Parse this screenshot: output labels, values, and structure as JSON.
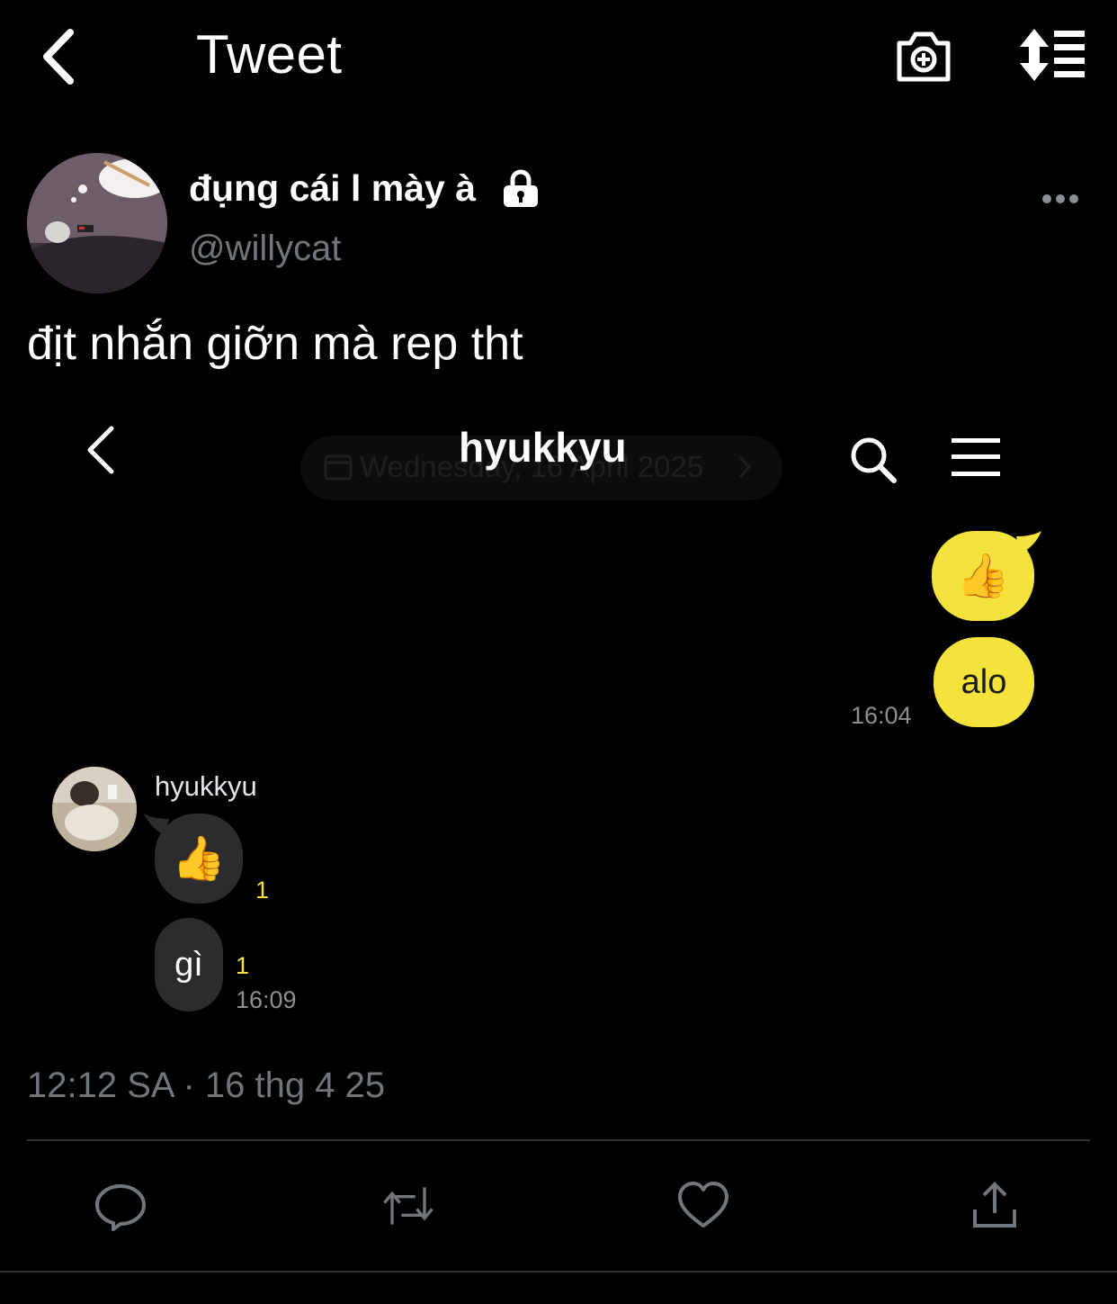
{
  "header": {
    "title": "Tweet"
  },
  "tweet": {
    "author_name": "đụng cái l mày à",
    "author_handle": "@willycat",
    "text": "địt nhắn giỡn mà rep tht",
    "timestamp": "12:12 SA · 16 thg 4 25"
  },
  "chat": {
    "title": "hyukkyu",
    "date_pill": "Wednesday, 16 April 2025",
    "messages": [
      {
        "side": "out",
        "content": "👍"
      },
      {
        "side": "out",
        "content": "alo",
        "time": "16:04"
      },
      {
        "side": "in",
        "sender": "hyukkyu",
        "content": "👍",
        "unread": "1"
      },
      {
        "side": "in",
        "content": "gì",
        "unread": "1",
        "time": "16:09"
      }
    ]
  },
  "colors": {
    "background": "#000000",
    "secondary_text": "#71767b",
    "bubble_out": "#f5e33d",
    "bubble_in": "#2c2c2e",
    "unread_count": "#f5e33d"
  },
  "icons": {
    "back": "chevron-left-icon",
    "camera": "camera-plus-icon",
    "sort": "sort-icon",
    "lock": "lock-icon",
    "more": "more-horizontal-icon",
    "reply": "reply-icon",
    "retweet": "retweet-icon",
    "like": "heart-icon",
    "share": "share-icon"
  }
}
